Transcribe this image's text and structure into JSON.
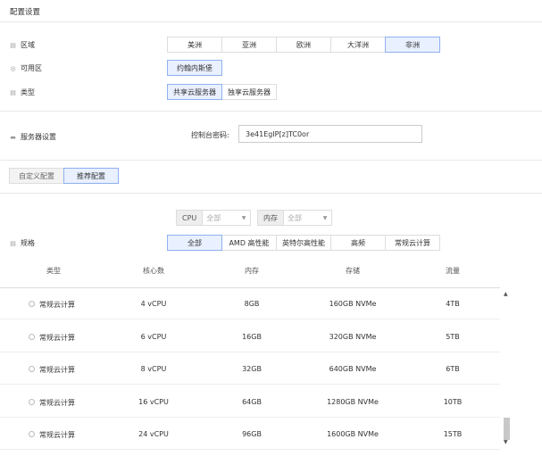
{
  "title": "配置设置",
  "region": {
    "label": "区域",
    "options": [
      "美洲",
      "亚洲",
      "欧洲",
      "大洋洲",
      "非洲"
    ],
    "selected": 4
  },
  "zone": {
    "label": "可用区",
    "value": "约翰内斯堡"
  },
  "type": {
    "label": "类型",
    "options": [
      "共享云服务器",
      "独享云服务器"
    ],
    "selected": 0
  },
  "server": {
    "label": "服务器设置",
    "pw_label": "控制台密码:",
    "pw_value": "3e41EgIP[z]TC0or"
  },
  "config_tabs": {
    "custom": "自定义配置",
    "recommended": "推荐配置",
    "selected": "recommended"
  },
  "spec": {
    "label": "规格",
    "cpu_filter": {
      "key": "CPU",
      "value": "全部"
    },
    "mem_filter": {
      "key": "内存",
      "value": "全部"
    },
    "categories": [
      "全部",
      "AMD 高性能",
      "英特尔高性能",
      "高频",
      "常规云计算"
    ],
    "selected": 0
  },
  "table": {
    "headers": [
      "类型",
      "核心数",
      "内存",
      "存储",
      "流量"
    ],
    "rows": [
      [
        "常规云计算",
        "4 vCPU",
        "8GB",
        "160GB NVMe",
        "4TB"
      ],
      [
        "常规云计算",
        "6 vCPU",
        "16GB",
        "320GB NVMe",
        "5TB"
      ],
      [
        "常规云计算",
        "8 vCPU",
        "32GB",
        "640GB NVMe",
        "6TB"
      ],
      [
        "常规云计算",
        "16 vCPU",
        "64GB",
        "1280GB NVMe",
        "10TB"
      ],
      [
        "常规云计算",
        "24 vCPU",
        "96GB",
        "1600GB NVMe",
        "15TB"
      ]
    ]
  }
}
